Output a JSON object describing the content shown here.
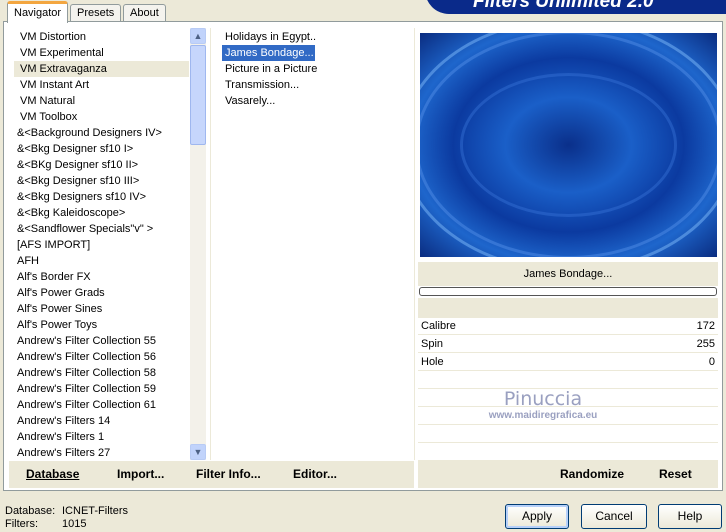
{
  "tabs": [
    "Navigator",
    "Presets",
    "About"
  ],
  "banner": "Filters Unlimited 2.0",
  "categories": [
    "VM Distortion",
    "VM Experimental",
    "VM Extravaganza",
    "VM Instant Art",
    "VM Natural",
    "VM Toolbox",
    "&<Background Designers IV>",
    "&<Bkg Designer sf10 I>",
    "&<BKg Designer sf10 II>",
    "&<Bkg Designer sf10 III>",
    "&<Bkg Designers sf10 IV>",
    "&<Bkg Kaleidoscope>",
    "&<Sandflower Specials\"v\" >",
    "[AFS IMPORT]",
    "AFH",
    "Alf's Border FX",
    "Alf's Power Grads",
    "Alf's Power Sines",
    "Alf's Power Toys",
    "Andrew's Filter Collection 55",
    "Andrew's Filter Collection 56",
    "Andrew's Filter Collection 58",
    "Andrew's Filter Collection 59",
    "Andrew's Filter Collection 61",
    "Andrew's Filters 14",
    "Andrew's Filters 1",
    "Andrew's Filters 27"
  ],
  "filters": [
    "Holidays in Egypt..",
    "James Bondage...",
    "Picture in a Picture",
    "Transmission...",
    "Vasarely..."
  ],
  "filter_name": "James Bondage...",
  "params": [
    {
      "label": "Calibre",
      "value": "172"
    },
    {
      "label": "Spin",
      "value": "255"
    },
    {
      "label": "Hole",
      "value": "0"
    }
  ],
  "watermark": {
    "name": "Pinuccia",
    "url": "www.maidiregrafica.eu"
  },
  "left_buttons": [
    "Database",
    "Import...",
    "Filter Info...",
    "Editor..."
  ],
  "right_buttons": [
    "Randomize",
    "Reset"
  ],
  "status": {
    "db_label": "Database:",
    "db_value": "ICNET-Filters",
    "filters_label": "Filters:",
    "filters_value": "1015"
  },
  "dialog_buttons": [
    "Apply",
    "Cancel",
    "Help"
  ],
  "progress": 0
}
